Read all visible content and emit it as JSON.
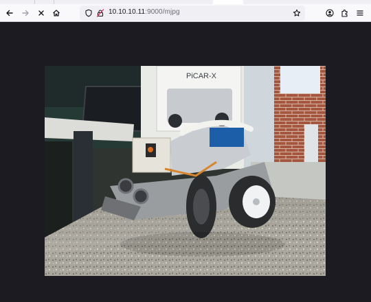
{
  "browser": {
    "address_host": "10.10.10.11",
    "address_path": ":9000/mjpg",
    "icons": [
      "back-arrow-icon",
      "forward-arrow-icon",
      "stop-loading-icon",
      "home-icon",
      "shield-icon",
      "insecure-lock-icon",
      "bookmark-star-icon",
      "account-icon",
      "extensions-icon",
      "menu-icon"
    ]
  },
  "stream": {
    "box_label": "PiCAR-X",
    "colors": {
      "page_bg": "#1c1b22",
      "toolbar_bg": "#f9f9fb",
      "urlbar_bg": "#f0f0f4",
      "insecure_red": "#e22850"
    }
  }
}
